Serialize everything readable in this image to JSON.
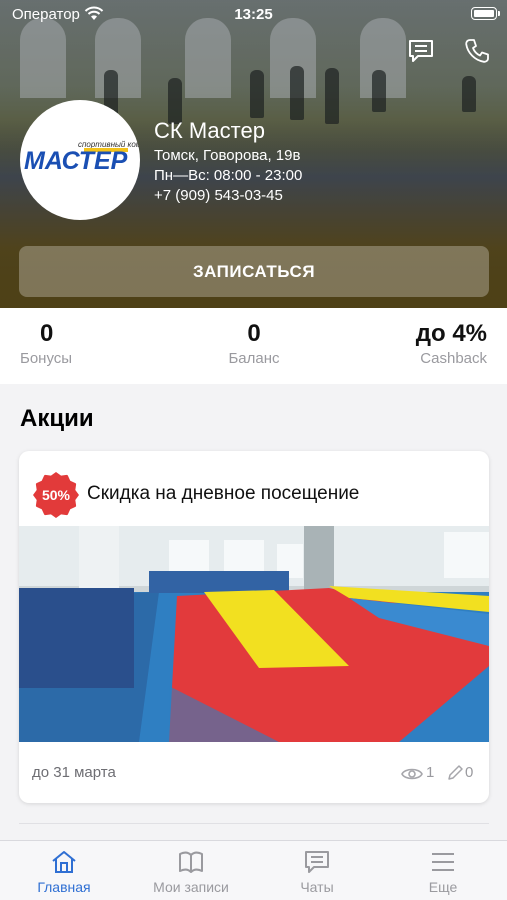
{
  "status_bar": {
    "carrier": "Оператор",
    "time": "13:25"
  },
  "club": {
    "logo_text": "МАСТЕР",
    "logo_tagline": "спортивный комплекс",
    "name": "СК Мастер",
    "address": "Томск, Говорова, 19в",
    "hours": "Пн—Вс: 08:00 - 23:00",
    "phone": "+7 (909) 543-03-45"
  },
  "signup_button": "ЗАПИСАТЬСЯ",
  "stats": {
    "bonus": {
      "value": "0",
      "label": "Бонусы"
    },
    "balance": {
      "value": "0",
      "label": "Баланс"
    },
    "cashback": {
      "value": "до 4%",
      "label": "Cashback"
    }
  },
  "promotions": {
    "title": "Акции",
    "items": [
      {
        "badge": "50%",
        "title": "Скидка на дневное посещение",
        "until": "до 31 марта",
        "views": "1",
        "edits": "0"
      }
    ]
  },
  "tabbar": [
    {
      "label": "Главная",
      "icon": "home-icon",
      "active": true
    },
    {
      "label": "Мои записи",
      "icon": "book-icon",
      "active": false
    },
    {
      "label": "Чаты",
      "icon": "chat-icon",
      "active": false
    },
    {
      "label": "Еще",
      "icon": "menu-icon",
      "active": false
    }
  ],
  "colors": {
    "accent": "#2f6fd3",
    "badge": "#e23a3a",
    "logo_blue": "#1a4fb3"
  }
}
